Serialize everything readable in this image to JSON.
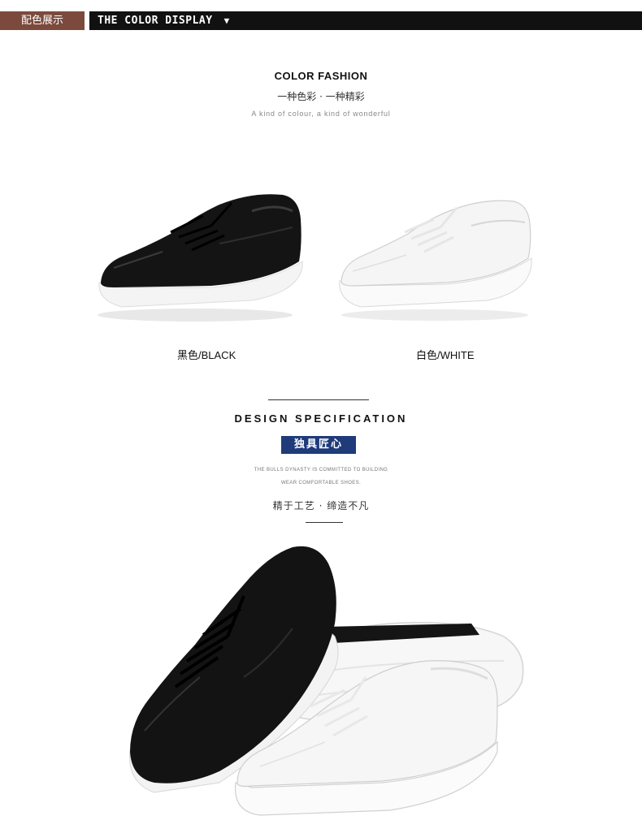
{
  "header": {
    "tag_label": "配色展示",
    "bar_title": "THE COLOR DISPLAY",
    "arrow_glyph": "▼"
  },
  "color_fashion": {
    "title": "COLOR FASHION",
    "subtitle_cn": "一种色彩 · 一种精彩",
    "subtitle_en": "A kind of colour, a kind of wonderful"
  },
  "variants": [
    {
      "label": "黑色/BLACK",
      "color": "#111111"
    },
    {
      "label": "白色/WHITE",
      "color": "#f6f6f6"
    }
  ],
  "design_spec": {
    "title": "DESIGN SPECIFICATION",
    "badge": "独具匠心",
    "line1_en": "THE BULLS DYNASTY IS COMMITTED TO BUILDING",
    "line2_en": "WEAR COMFORTABLE SHOES.",
    "tagline_cn": "精于工艺 · 缔造不凡"
  },
  "colors": {
    "header_tag_bg": "#7b4a3c",
    "header_bar_bg": "#111111",
    "badge_bg": "#1f3b7a"
  }
}
